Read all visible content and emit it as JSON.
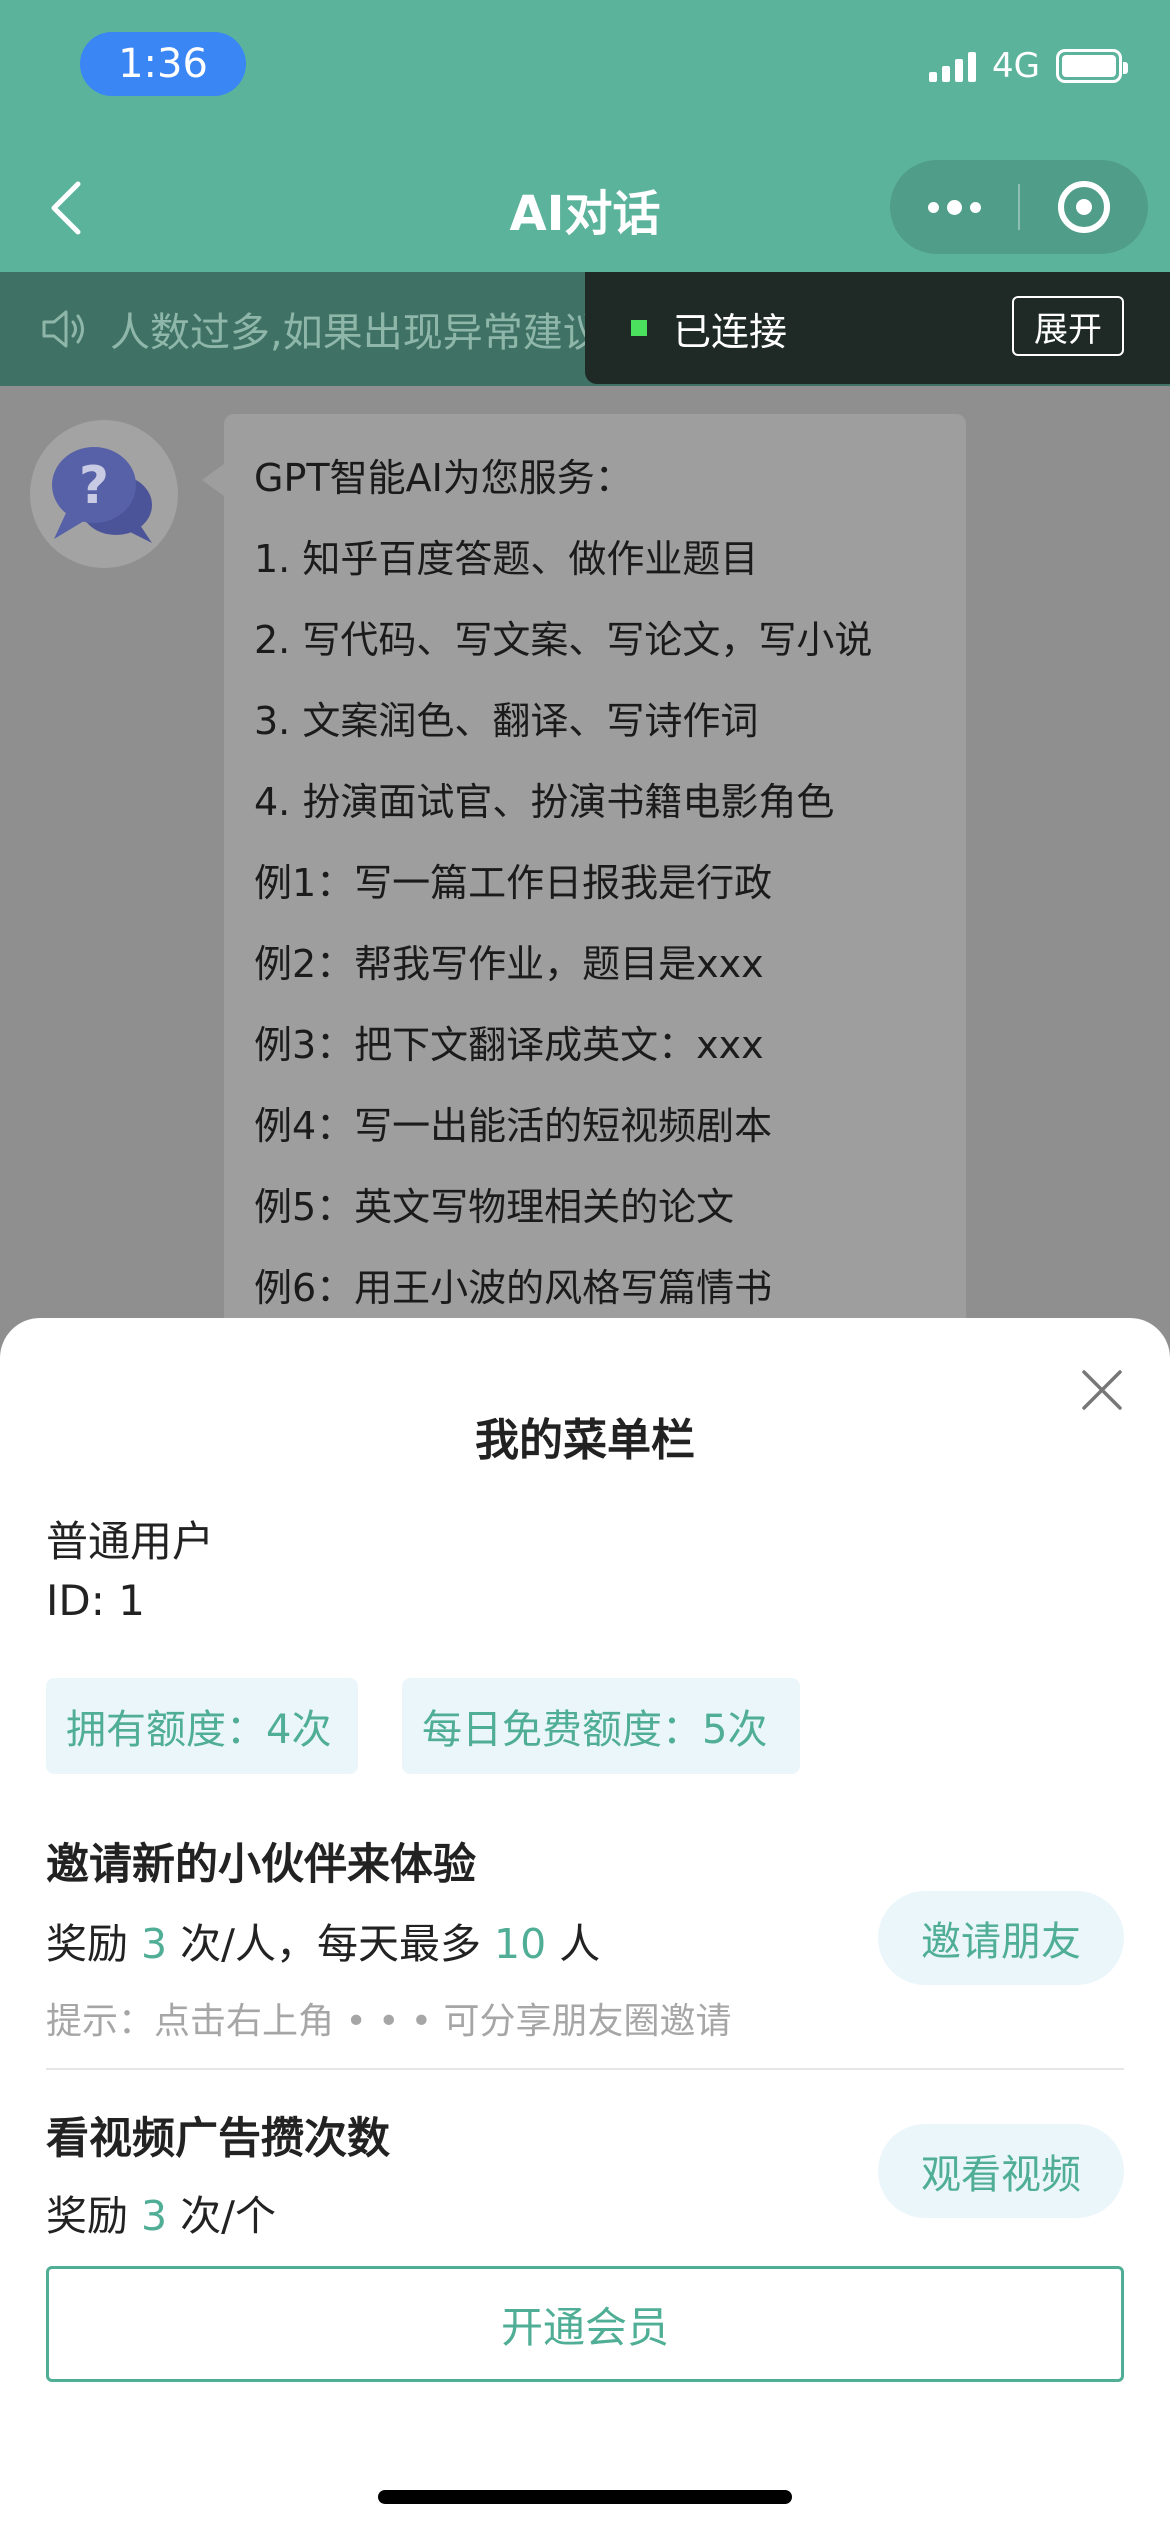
{
  "status_bar": {
    "time": "1:36",
    "network": "4G"
  },
  "nav": {
    "title": "AI对话"
  },
  "notice": {
    "text": "人数过多,如果出现异常建议重新进入,AI对话已支持xxx"
  },
  "toast": {
    "label": "已连接",
    "expand": "展开"
  },
  "chat": {
    "lines": [
      "GPT智能AI为您服务：",
      "1. 知乎百度答题、做作业题目",
      "2. 写代码、写文案、写论文，写小说",
      "3. 文案润色、翻译、写诗作词",
      "4. 扮演面试官、扮演书籍电影角色",
      "例1：写一篇工作日报我是行政",
      "例2：帮我写作业，题目是xxx",
      "例3：把下文翻译成英文：xxx",
      "例4：写一出能活的短视频剧本",
      "例5：英文写物理相关的论文",
      "例6：用王小波的风格写篇情书"
    ]
  },
  "sheet": {
    "title": "我的菜单栏",
    "user_type": "普通用户",
    "user_id": "ID: 1",
    "quota_owned": "拥有额度：4次",
    "quota_daily": "每日免费额度：5次",
    "invite": {
      "title": "邀请新的小伙伴来体验",
      "reward_prefix": "奖励 ",
      "reward_count": "3",
      "reward_mid": " 次/人，每天最多 ",
      "reward_max": "10",
      "reward_suffix": " 人",
      "hint": "提示：点击右上角 • • • 可分享朋友圈邀请",
      "button": "邀请朋友"
    },
    "video": {
      "title": "看视频广告攒次数",
      "reward_prefix": "奖励 ",
      "reward_count": "3",
      "reward_suffix": " 次/个",
      "button": "观看视频"
    },
    "member_button": "开通会员"
  },
  "colors": {
    "brand": "#5cb39c",
    "accent_text": "#4fae95",
    "status_pill": "#3a86f4"
  }
}
